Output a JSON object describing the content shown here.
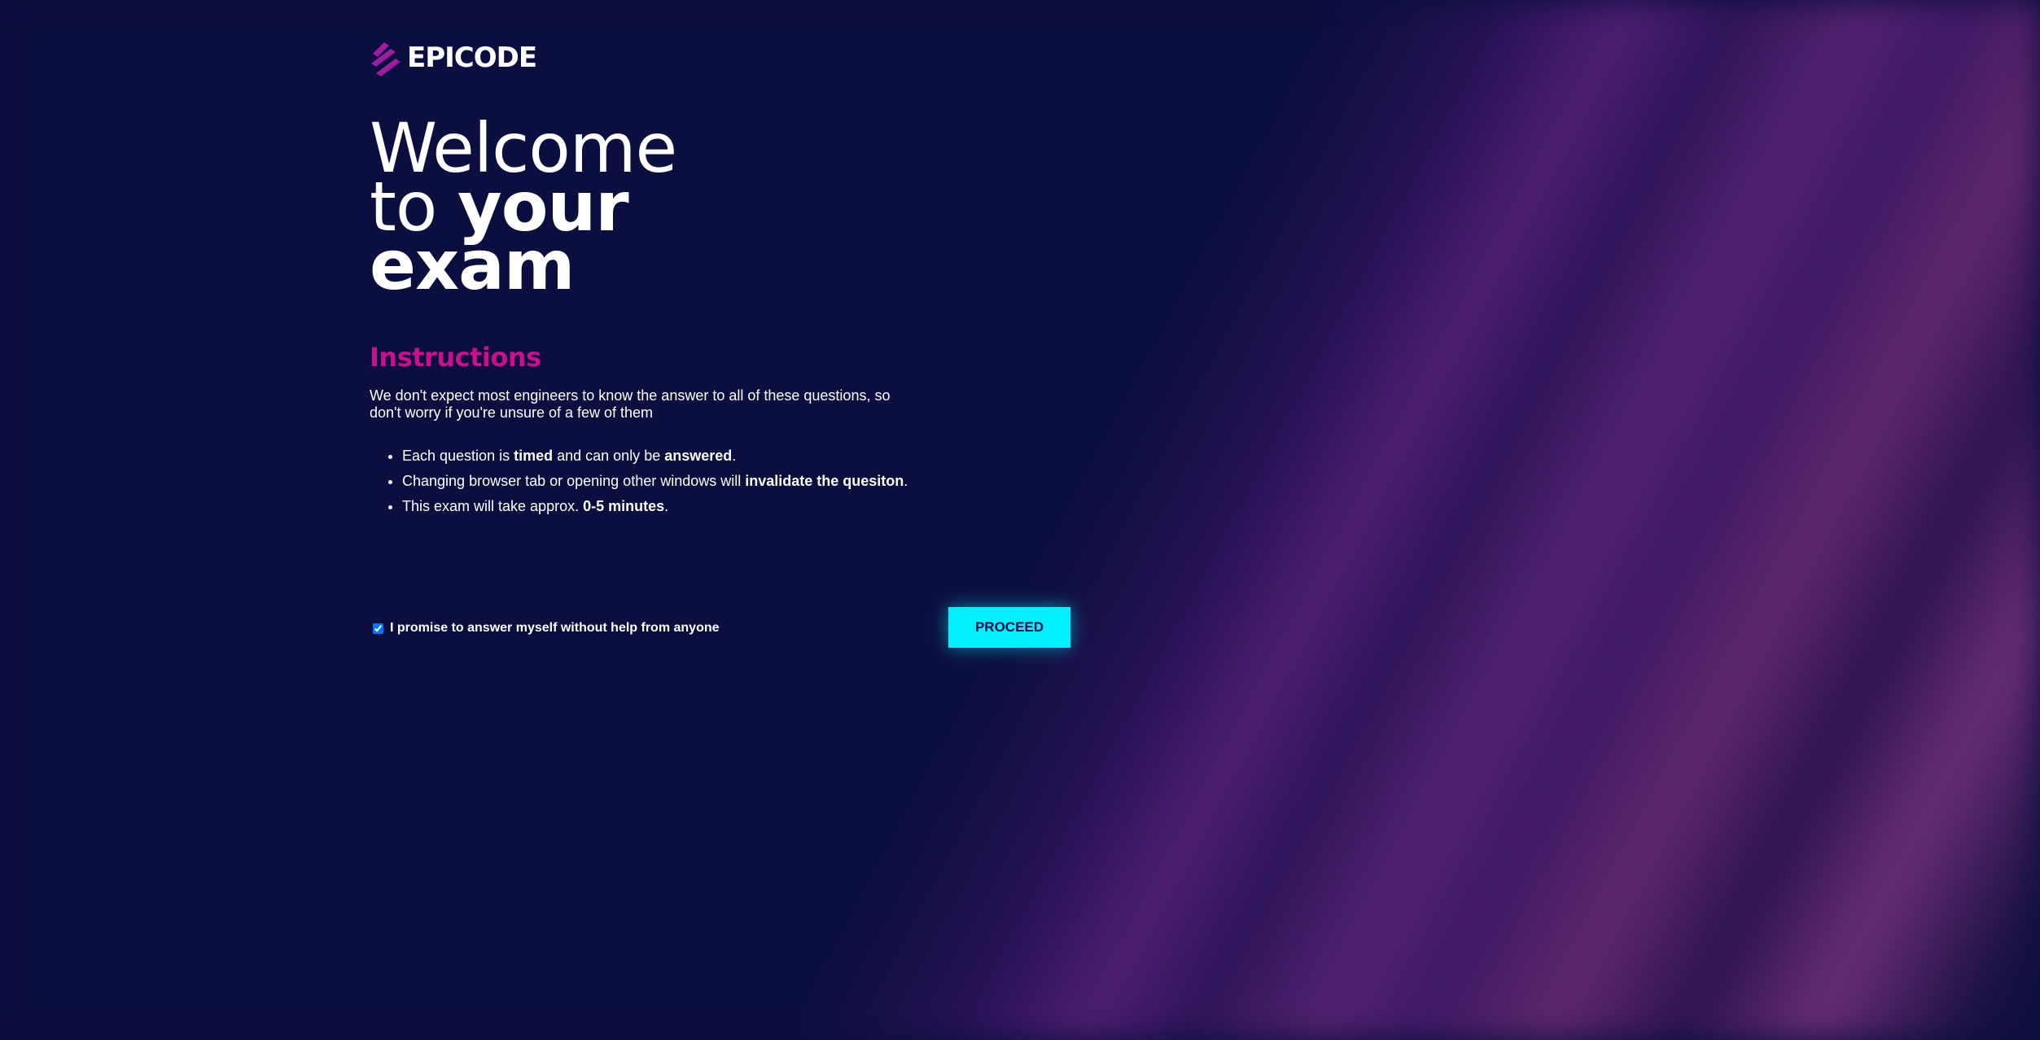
{
  "brand": {
    "name": "EPICODE",
    "logo_icon": "epicode-slash-logo"
  },
  "hero": {
    "line1": "Welcome",
    "line2_regular": "to ",
    "line2_bold": "your",
    "line3_bold": "exam"
  },
  "instructions": {
    "title": "Instructions",
    "intro": "We don't expect most engineers to know the answer to all of these questions, so don't worry if you're unsure of a few of them",
    "rules": [
      {
        "parts": [
          {
            "text": "Each question is ",
            "bold": false
          },
          {
            "text": "timed",
            "bold": true
          },
          {
            "text": " and can only be ",
            "bold": false
          },
          {
            "text": "answered",
            "bold": true
          },
          {
            "text": ".",
            "bold": false
          }
        ]
      },
      {
        "parts": [
          {
            "text": "Changing browser tab or opening other windows will ",
            "bold": false
          },
          {
            "text": "invalidate the quesiton",
            "bold": true
          },
          {
            "text": ".",
            "bold": false
          }
        ]
      },
      {
        "parts": [
          {
            "text": "This exam will take approx. ",
            "bold": false
          },
          {
            "text": "0-5 minutes",
            "bold": true
          },
          {
            "text": ".",
            "bold": false
          }
        ]
      }
    ]
  },
  "promise": {
    "label": "I promise to answer myself without help from anyone",
    "checked": true
  },
  "actions": {
    "proceed_label": "PROCEED"
  },
  "colors": {
    "background": "#0b0f3f",
    "accent_pink": "#c8108f",
    "button_cyan": "#00f0ff"
  }
}
